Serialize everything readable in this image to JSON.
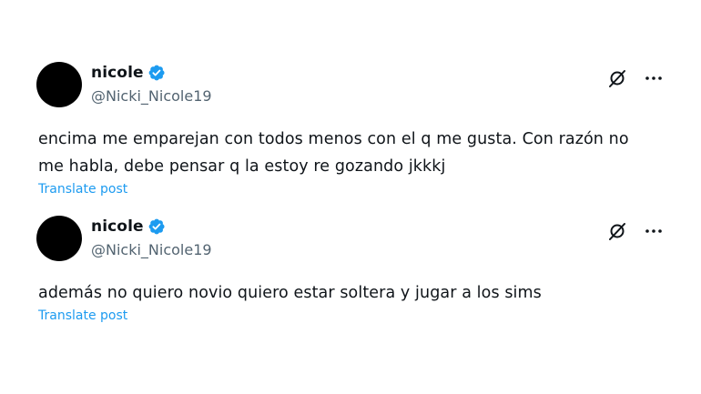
{
  "posts": [
    {
      "display_name": "nicole",
      "handle": "@Nicki_Nicole19",
      "text_lines": [
        "encima me emparejan con todos menos con el q me gusta. Con razón no",
        "me habla, debe pensar q la estoy re gozando jkkkj"
      ],
      "translate_label": "Translate post",
      "verified": true
    },
    {
      "display_name": "nicole",
      "handle": "@Nicki_Nicole19",
      "text_lines": [
        "además no quiero novio quiero estar soltera y jugar a los sims"
      ],
      "translate_label": "Translate post",
      "verified": true
    }
  ],
  "icons": {
    "verified": "verified-badge-icon",
    "grok": "grok-icon",
    "more": "more-options-icon"
  },
  "colors": {
    "verified_blue": "#1d9bf0",
    "link_blue": "#1d9bf0",
    "secondary_text": "#536471",
    "primary_text": "#0f1419",
    "avatar": "#000000"
  }
}
